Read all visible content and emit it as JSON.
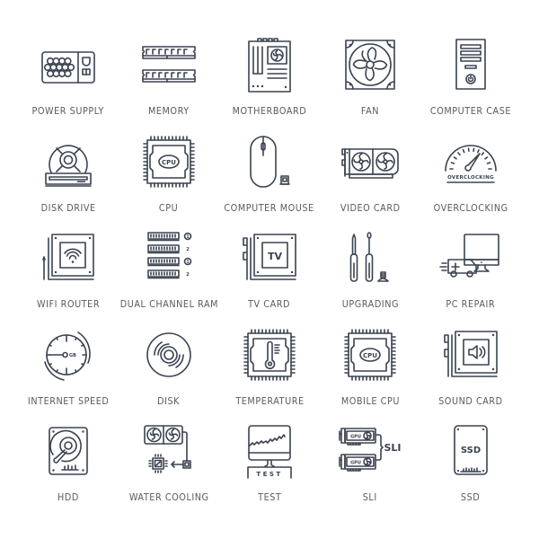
{
  "icon_color": "#3a4350",
  "label_color": "#555b63",
  "items": [
    {
      "label": "POWER SUPPLY",
      "icon": "power-supply-icon"
    },
    {
      "label": "MEMORY",
      "icon": "memory-icon"
    },
    {
      "label": "MOTHERBOARD",
      "icon": "motherboard-icon"
    },
    {
      "label": "FAN",
      "icon": "fan-icon"
    },
    {
      "label": "COMPUTER CASE",
      "icon": "computer-case-icon"
    },
    {
      "label": "DISK DRIVE",
      "icon": "disk-drive-icon"
    },
    {
      "label": "CPU",
      "icon": "cpu-icon",
      "inner_text": "CPU"
    },
    {
      "label": "COMPUTER MOUSE",
      "icon": "computer-mouse-icon"
    },
    {
      "label": "VIDEO CARD",
      "icon": "video-card-icon"
    },
    {
      "label": "OVERCLOCKING",
      "icon": "overclocking-icon",
      "inner_text": "OVERCLOCKING"
    },
    {
      "label": "WIFI ROUTER",
      "icon": "wifi-router-icon"
    },
    {
      "label": "DUAL CHANNEL RAM",
      "icon": "dual-channel-ram-icon",
      "slot_numbers": [
        "1",
        "2",
        "1",
        "2"
      ]
    },
    {
      "label": "TV CARD",
      "icon": "tv-card-icon",
      "inner_text": "TV"
    },
    {
      "label": "UPGRADING",
      "icon": "upgrading-icon"
    },
    {
      "label": "PC REPAIR",
      "icon": "pc-repair-icon"
    },
    {
      "label": "INTERNET SPEED",
      "icon": "internet-speed-icon",
      "inner_text": "GB"
    },
    {
      "label": "DISK",
      "icon": "disk-icon"
    },
    {
      "label": "TEMPERATURE",
      "icon": "temperature-icon"
    },
    {
      "label": "MOBILE CPU",
      "icon": "mobile-cpu-icon",
      "inner_text": "CPU"
    },
    {
      "label": "SOUND CARD",
      "icon": "sound-card-icon"
    },
    {
      "label": "HDD",
      "icon": "hdd-icon"
    },
    {
      "label": "WATER COOLING",
      "icon": "water-cooling-icon"
    },
    {
      "label": "TEST",
      "icon": "test-icon",
      "inner_text": "TEST"
    },
    {
      "label": "SLI",
      "icon": "sli-icon",
      "inner_text": "SLI",
      "gpu_text": "GPU"
    },
    {
      "label": "SSD",
      "icon": "ssd-icon",
      "inner_text": "SSD"
    }
  ]
}
